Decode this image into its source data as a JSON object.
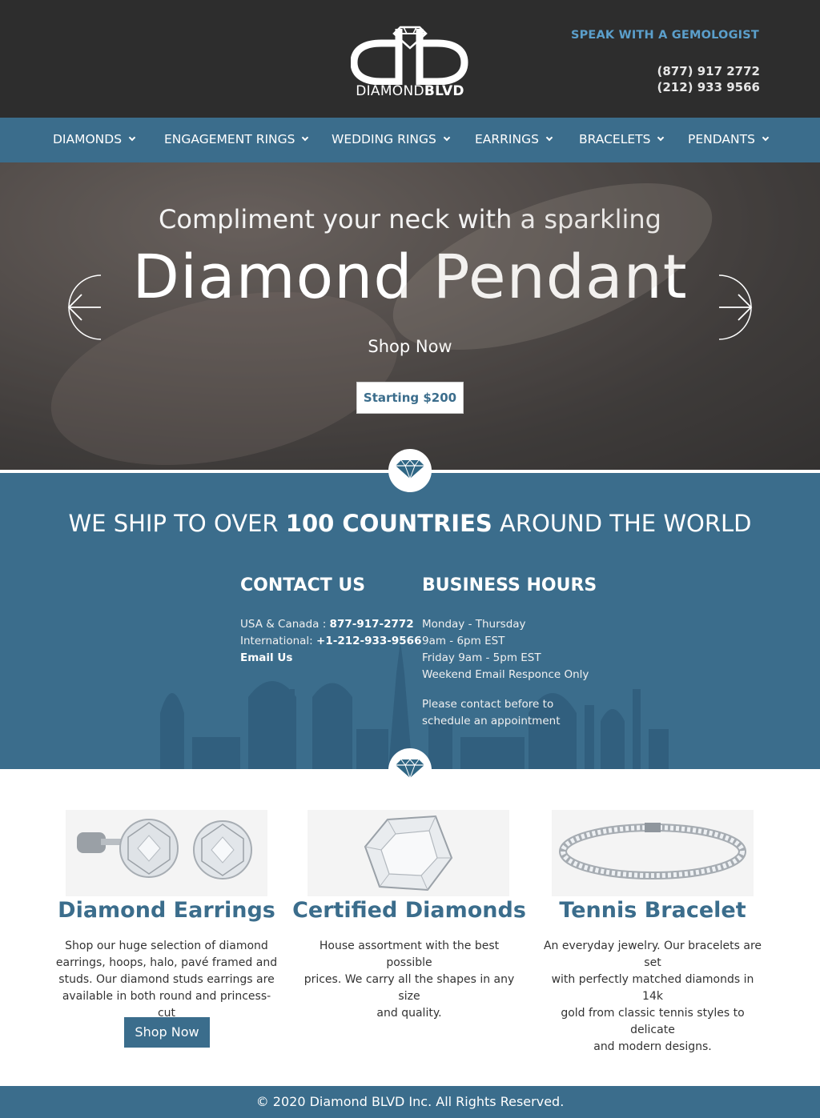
{
  "header": {
    "logo_word_1": "DIAMOND",
    "logo_word_2": "BLVD",
    "gemologist_label": "SPEAK WITH A GEMOLOGIST",
    "phone_1": "(877) 917 2772",
    "phone_2": "(212) 933 9566"
  },
  "nav": {
    "items": [
      {
        "label": "DIAMONDS"
      },
      {
        "label": "ENGAGEMENT RINGS"
      },
      {
        "label": "WEDDING RINGS"
      },
      {
        "label": "EARRINGS"
      },
      {
        "label": "BRACELETS"
      },
      {
        "label": "PENDANTS"
      }
    ]
  },
  "hero": {
    "subtitle": "Compliment your neck with a sparkling",
    "title": "Diamond Pendant",
    "shop_label": "Shop Now",
    "price_label": "Starting $200"
  },
  "ship": {
    "title_pre": "WE SHIP TO OVER ",
    "title_bold": "100 COUNTRIES",
    "title_post": " AROUND THE WORLD"
  },
  "contact": {
    "heading": "CONTACT US",
    "usa_label": "USA & Canada : ",
    "usa_phone": "877-917-2772",
    "intl_label": "International: ",
    "intl_phone": "+1-212-933-9566",
    "email_label": "Email Us"
  },
  "hours": {
    "heading": "BUSINESS HOURS",
    "line_1": "Monday - Thursday",
    "line_2": "9am - 6pm EST",
    "line_3": "Friday 9am - 5pm EST",
    "line_4": "Weekend Email Responce Only",
    "note_1": "Please contact before to",
    "note_2": "schedule an appointment"
  },
  "products": [
    {
      "title": "Diamond Earrings",
      "desc_lines": [
        "Shop our huge selection of diamond",
        "earrings, hoops, halo, pavé framed and",
        "studs. Our diamond studs earrings are",
        "available in both round and princess-cut"
      ],
      "button": "Shop Now"
    },
    {
      "title": "Certified Diamonds",
      "desc_lines": [
        "House assortment with the best possible",
        "prices. We carry all the shapes in any size",
        "and quality."
      ]
    },
    {
      "title": "Tennis Bracelet",
      "desc_lines": [
        "An everyday jewelry. Our bracelets are set",
        "with perfectly matched diamonds in 14k",
        "gold from classic tennis styles to delicate",
        "and modern designs."
      ]
    }
  ],
  "footer": {
    "copyright": "© 2020 Diamond BLVD Inc. All Rights Reserved."
  },
  "colors": {
    "header_bg": "#2d2d2d",
    "brand_blue": "#3b6d8c",
    "link_blue": "#5b9fcb"
  }
}
